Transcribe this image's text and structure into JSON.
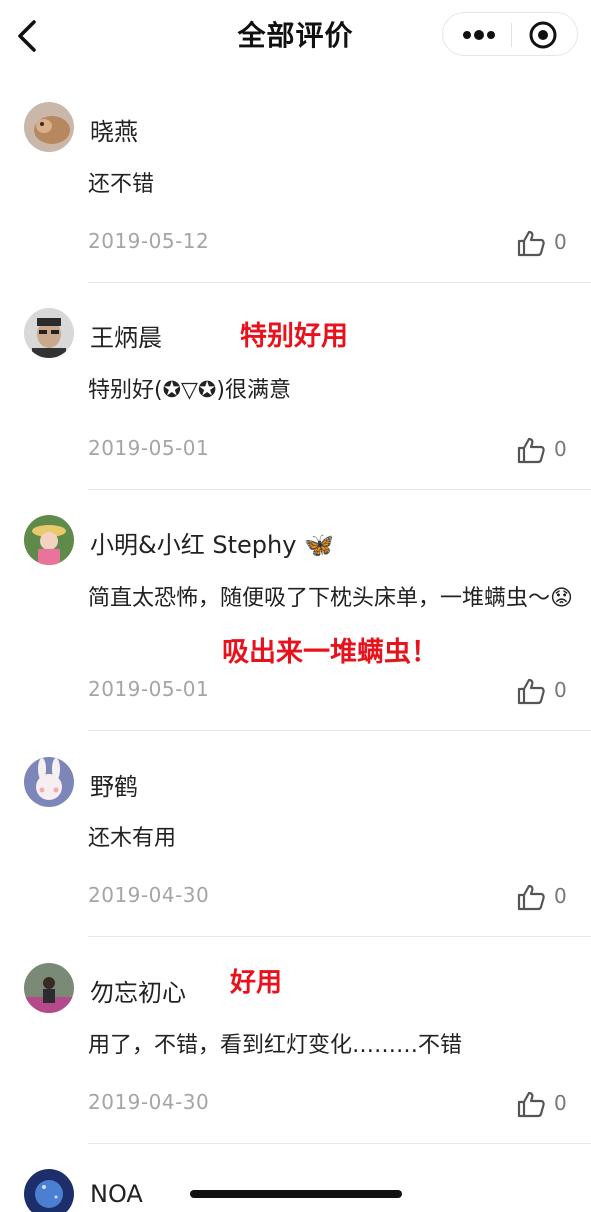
{
  "header": {
    "title": "全部评价"
  },
  "reviews": [
    {
      "name": "晓燕",
      "text": "还不错",
      "date": "2019-05-12",
      "likes": "0"
    },
    {
      "name": "王炳晨",
      "text": "特别好(✪▽✪)很满意",
      "date": "2019-05-01",
      "likes": "0"
    },
    {
      "name": "小明&小红 Stephy 🦋",
      "text": "简直太恐怖，随便吸了下枕头床单，一堆螨虫～😟",
      "date": "2019-05-01",
      "likes": "0"
    },
    {
      "name": "野鹤",
      "text": "还木有用",
      "date": "2019-04-30",
      "likes": "0"
    },
    {
      "name": "勿忘初心",
      "text": "用了，不错，看到红灯变化………不错",
      "date": "2019-04-30",
      "likes": "0"
    },
    {
      "name": "NOA"
    }
  ],
  "annotations": {
    "a1": "特别好用",
    "a2": "吸出来一堆螨虫！",
    "a3": "好用"
  },
  "colors": {
    "annotation": "#e8121c",
    "date": "#a5a5a5"
  }
}
